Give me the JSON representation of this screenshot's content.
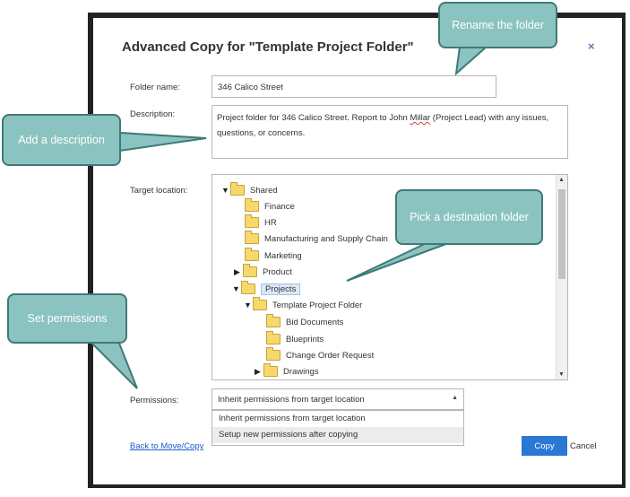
{
  "dialog": {
    "title": "Advanced Copy for \"Template Project Folder\"",
    "close_icon": "×",
    "folder_name_label": "Folder name:",
    "folder_name_value": "346 Calico Street",
    "description_label": "Description:",
    "description_before": "Project folder for 346 Calico Street. Report to John ",
    "description_misspelled": "Millar",
    "description_after": " (Project Lead) with any issues, questions, or concerns.",
    "target_label": "Target location:",
    "tree": [
      {
        "label": "Shared",
        "expander": "▼"
      },
      {
        "label": "Finance",
        "expander": ""
      },
      {
        "label": "HR",
        "expander": ""
      },
      {
        "label": "Manufacturing and Supply Chain",
        "expander": ""
      },
      {
        "label": "Marketing",
        "expander": ""
      },
      {
        "label": "Product",
        "expander": "▶"
      },
      {
        "label": "Projects",
        "expander": "▼"
      },
      {
        "label": "Template Project Folder",
        "expander": "▼"
      },
      {
        "label": "Bid Documents",
        "expander": ""
      },
      {
        "label": "Blueprints",
        "expander": ""
      },
      {
        "label": "Change Order Request",
        "expander": ""
      },
      {
        "label": "Drawings",
        "expander": "▶"
      }
    ],
    "scroll_up": "▲",
    "scroll_down": "▼",
    "permissions_label": "Permissions:",
    "permissions_selected": "Inherit permissions from target location",
    "permissions_caret": "▲",
    "permissions_options": [
      "Inherit permissions from target location",
      "Setup new permissions after copying"
    ],
    "back_link": "Back to Move/Copy",
    "copy_button": "Copy",
    "cancel_button": "Cancel"
  },
  "callouts": {
    "rename": "Rename the folder",
    "description": "Add a description",
    "destination": "Pick a destination folder",
    "permissions": "Set permissions"
  },
  "colors": {
    "callout_fill": "#8ac3c0",
    "callout_border": "#3f7a77",
    "primary_button": "#2a77d4",
    "link": "#1a5ccc"
  }
}
